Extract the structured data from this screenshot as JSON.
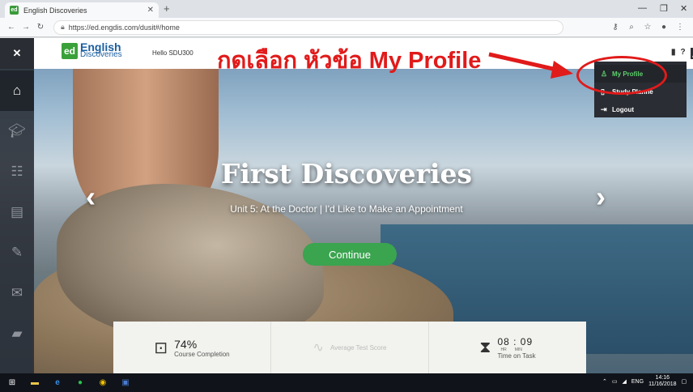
{
  "browser": {
    "tab_title": "English Discoveries",
    "tab_favicon": "ed",
    "url": "https://ed.engdis.com/dusit#/home",
    "colors": {
      "chrome": "#dee1e6"
    }
  },
  "header": {
    "logo_mark": "ed",
    "logo_brand_line1": "English",
    "logo_brand_line2": "Discoveries",
    "greeting": "Hello SDU300",
    "help_label": "?"
  },
  "annotation": {
    "text": "กดเลือก หัวข้อ My Profile",
    "color": "#e11a1a"
  },
  "user_menu": {
    "items": [
      {
        "label": "My Profile",
        "icon": "user-icon",
        "selected": true
      },
      {
        "label": "Study Planne",
        "icon": "notebook-icon",
        "selected": false
      },
      {
        "label": "Logout",
        "icon": "logout-icon",
        "selected": false
      }
    ]
  },
  "sidebar": {
    "items": [
      {
        "icon": "home-icon",
        "active": true
      },
      {
        "icon": "graduation-cap-icon",
        "active": false
      },
      {
        "icon": "community-icon",
        "active": false
      },
      {
        "icon": "clipboard-icon",
        "active": false
      },
      {
        "icon": "assignments-icon",
        "active": false
      },
      {
        "icon": "messages-icon",
        "active": false
      },
      {
        "icon": "book-icon",
        "active": false
      }
    ]
  },
  "hero": {
    "title": "First Discoveries",
    "subtitle": "Unit 5: At the Doctor | I'd Like to Make an Appointment",
    "continue_label": "Continue",
    "accent": "#3aa44f"
  },
  "stats": {
    "completion_value": "74%",
    "completion_label": "Course Completion",
    "test_label": "Average Test Score",
    "time_value": "08 : 09",
    "time_hr": "HR",
    "time_min": "MIN",
    "time_label": "Time on Task"
  },
  "taskbar": {
    "lang": "ENG",
    "time": "14:16",
    "date": "11/16/2018"
  }
}
